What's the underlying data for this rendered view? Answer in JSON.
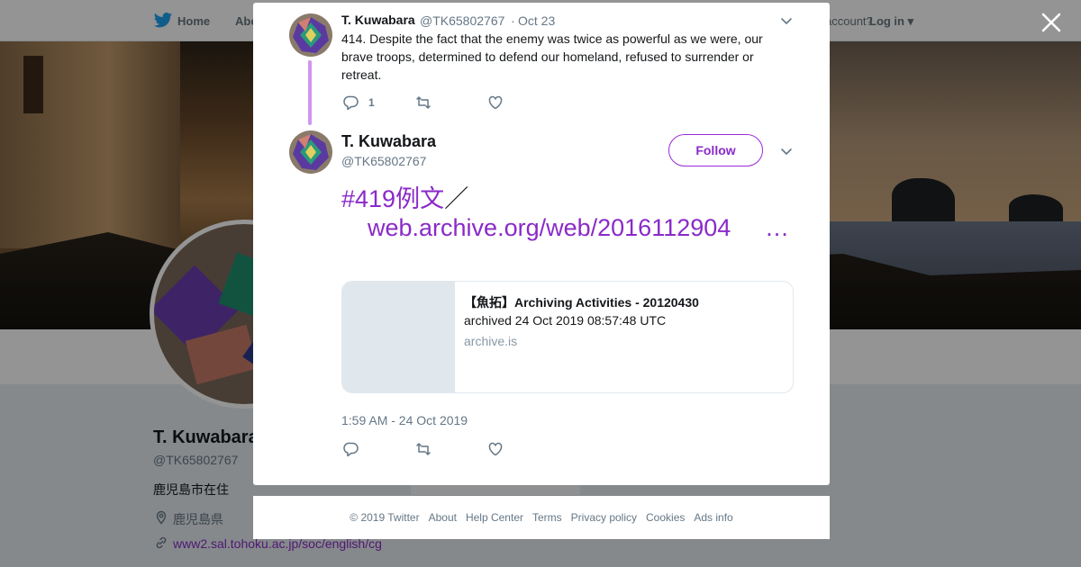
{
  "background_page": {
    "nav": {
      "home": "Home",
      "about": "Abo",
      "account_prompt": "account?",
      "login": "Log in"
    },
    "profile": {
      "name": "T. Kuwabara",
      "handle": "@TK65802767",
      "bio": "鹿児島市在住",
      "location": "鹿児島県",
      "link": "www2.sal.tohoku.ac.jp/soc/english/cg",
      "ads_snippet": "Ads info"
    }
  },
  "modal": {
    "parent_tweet": {
      "name": "T. Kuwabara",
      "handle": "@TK65802767",
      "separator": "·",
      "date": "Oct 23",
      "text": "414. Despite the fact that the enemy was twice as powerful as we were, our brave troops, determined to defend our homeland, refused to surrender or retreat.",
      "reply_count": "1"
    },
    "main_tweet": {
      "name": "T. Kuwabara",
      "handle": "@TK65802767",
      "follow_label": "Follow",
      "hashtag": "#419例文",
      "separator": "／",
      "link_text": "web.archive.org/web/2016112904",
      "ellipsis": "…",
      "card": {
        "title": "【魚拓】Archiving Activities - 20120430",
        "description": "archived 24 Oct 2019 08:57:48 UTC",
        "domain": "archive.is"
      },
      "timestamp": "1:59 AM - 24 Oct 2019"
    }
  },
  "footer": {
    "copyright": "© 2019 Twitter",
    "links": [
      "About",
      "Help Center",
      "Terms",
      "Privacy policy",
      "Cookies",
      "Ads info"
    ]
  },
  "colors": {
    "accent": "#8a2ac9",
    "thread_line": "#cf96f0",
    "muted": "#657786",
    "card_border": "#e1e8ed"
  },
  "icons": [
    "twitter-bird-icon",
    "close-icon",
    "chevron-down-icon",
    "reply-icon",
    "retweet-icon",
    "like-icon",
    "location-icon",
    "link-icon"
  ]
}
